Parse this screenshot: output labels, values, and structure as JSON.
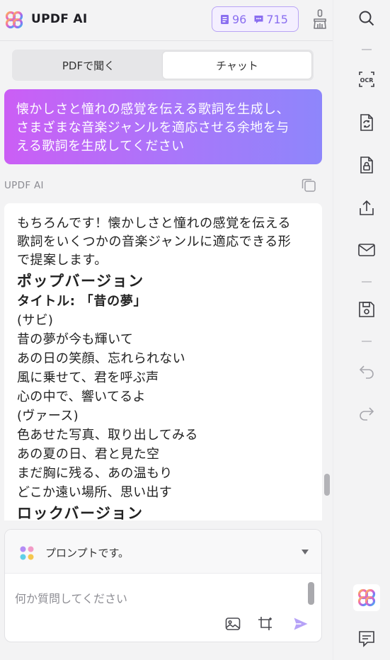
{
  "header": {
    "brand": "UPDF AI",
    "credits": {
      "documents": "96",
      "messages": "715"
    }
  },
  "tabs": [
    {
      "label": "PDFで聞く",
      "active": false
    },
    {
      "label": "チャット",
      "active": true
    }
  ],
  "user_message": {
    "lines": [
      "懐かしさと憧れの感覚を伝える歌詞を生成し、",
      "さまざまな音楽ジャンルを適応させる余地を与",
      "える歌詞を生成してください"
    ]
  },
  "ai_label": "UPDF AI",
  "reply": {
    "intro": [
      "もちろんです！懐かしさと憧れの感覚を伝える",
      "歌詞をいくつかの音楽ジャンルに適応できる形",
      "で提案します。"
    ],
    "section1_heading": "ポップバージョン",
    "section1_title": "タイトル: 「昔の夢」",
    "lyrics": [
      "(サビ)",
      "昔の夢が今も輝いて",
      "あの日の笑顔、忘れられない",
      "風に乗せて、君を呼ぶ声",
      "心の中で、響いてるよ",
      "(ヴァース)",
      "色あせた写真、取り出してみる",
      "あの夏の日、君と見た空",
      "まだ胸に残る、あの温もり",
      "どこか遠い場所、思い出す"
    ],
    "section2_heading": "ロックバージョン"
  },
  "composer": {
    "prompt_label": "プロンプトです。",
    "input_placeholder": "何か質問してください"
  },
  "toolbar": {
    "icons": [
      "search-icon",
      "ocr-icon",
      "convert-icon",
      "protect-icon",
      "share-icon",
      "email-icon",
      "save-icon",
      "undo-icon",
      "redo-icon",
      "updf-ai-icon",
      "comment-icon"
    ]
  },
  "colors": {
    "accent": "#8a6ef0",
    "gradient_start": "#cb5ef5",
    "gradient_end": "#8e86fb"
  }
}
